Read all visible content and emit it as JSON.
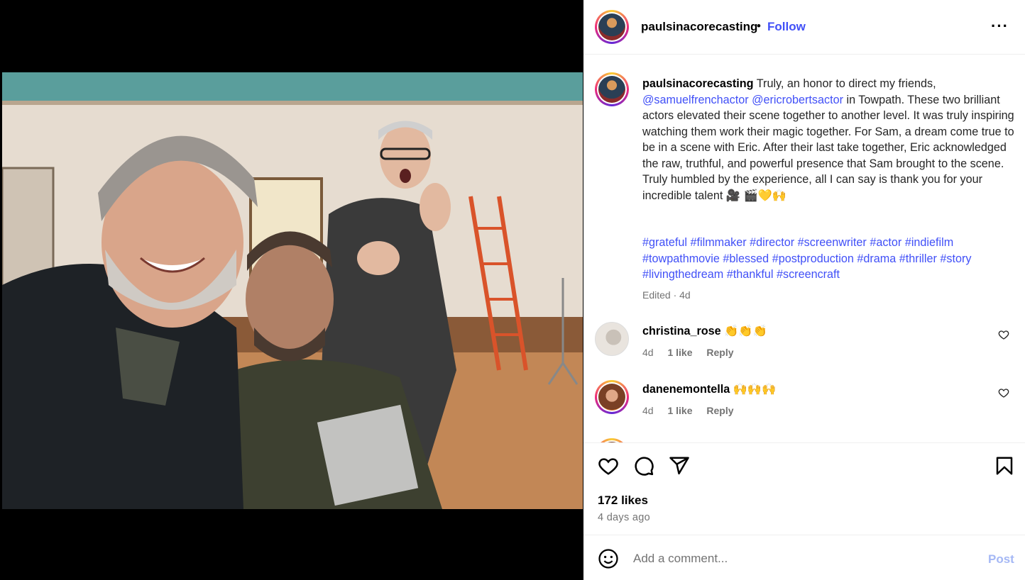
{
  "post": {
    "username": "paulsinacorecasting",
    "separator": "•",
    "follow_label": "Follow",
    "more_icon": "more-horizontal-icon",
    "caption_intro": "Truly, an honor to direct my friends,",
    "mention1": "@samuelfrenchactor",
    "mention2": "@ericrobertsactor",
    "caption_body": "in Towpath. These two brilliant actors elevated their scene together to another level. It was truly inspiring watching them work their magic together. For Sam, a dream come true to be in a scene with Eric. After their last take together, Eric acknowledged the raw, truthful, and powerful presence that Sam brought to the scene. Truly humbled by the experience, all I can say is thank you for your incredible talent 🎥",
    "caption_emojis": "🎬💛🙌",
    "hashtags": [
      "#grateful",
      "#filmmaker",
      "#director",
      "#screenwriter",
      "#actor",
      "#indiefilm",
      "#towpathmovie",
      "#blessed",
      "#postproduction",
      "#drama",
      "#thriller",
      "#story",
      "#livingthedream",
      "#thankful",
      "#screencraft"
    ],
    "edited": "Edited · 4d"
  },
  "comments": [
    {
      "username": "christina_rose",
      "text": "👏👏👏",
      "time": "4d",
      "likes": "1 like",
      "reply": "Reply"
    },
    {
      "username": "danenemontella",
      "text": "🙌🙌🙌",
      "time": "4d",
      "likes": "1 like",
      "reply": "Reply"
    }
  ],
  "stats": {
    "likes": "172 likes",
    "time_ago": "4 days ago"
  },
  "add_comment": {
    "placeholder": "Add a comment...",
    "post_label": "Post"
  },
  "colors": {
    "accent": "#4150f7",
    "muted": "#737373",
    "post_disabled": "#a5b8f5"
  }
}
